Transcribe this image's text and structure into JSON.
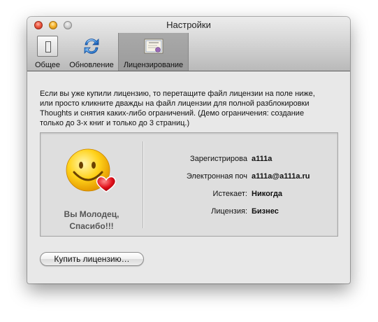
{
  "window": {
    "title": "Настройки"
  },
  "toolbar": {
    "tabs": [
      {
        "label": "Общее",
        "icon": "switch-icon"
      },
      {
        "label": "Обновление",
        "icon": "sync-arrows-icon"
      },
      {
        "label": "Лицензирование",
        "icon": "license-certificate-icon",
        "selected": true
      }
    ]
  },
  "description": {
    "lines": [
      "Если вы уже купили лицензию, то перетащите файл лицензии на поле ниже,",
      "или просто кликните дважды на файл лицензии для полной разблокировки",
      "Thoughts и снятия каких-либо ограничений. (Демо ограничения: создание",
      "только до 3-х книг и только до 3 страниц.)"
    ]
  },
  "license_panel": {
    "thanks_lines": [
      "Вы Молодец,",
      "Спасибо!!!"
    ],
    "fields": [
      {
        "label": "Зарегистрирова",
        "value": "a111a"
      },
      {
        "label": "Электронная поч",
        "value": "a111a@a111a.ru"
      },
      {
        "label": "Истекает:",
        "value": "Никогда"
      },
      {
        "label": "Лицензия:",
        "value": "Бизнес"
      }
    ]
  },
  "buy_button": {
    "label": "Купить лицензию…"
  },
  "colors": {
    "window_bg": "#e8e8e8",
    "panel_bg": "#dedede",
    "thanks_text": "#555555"
  }
}
